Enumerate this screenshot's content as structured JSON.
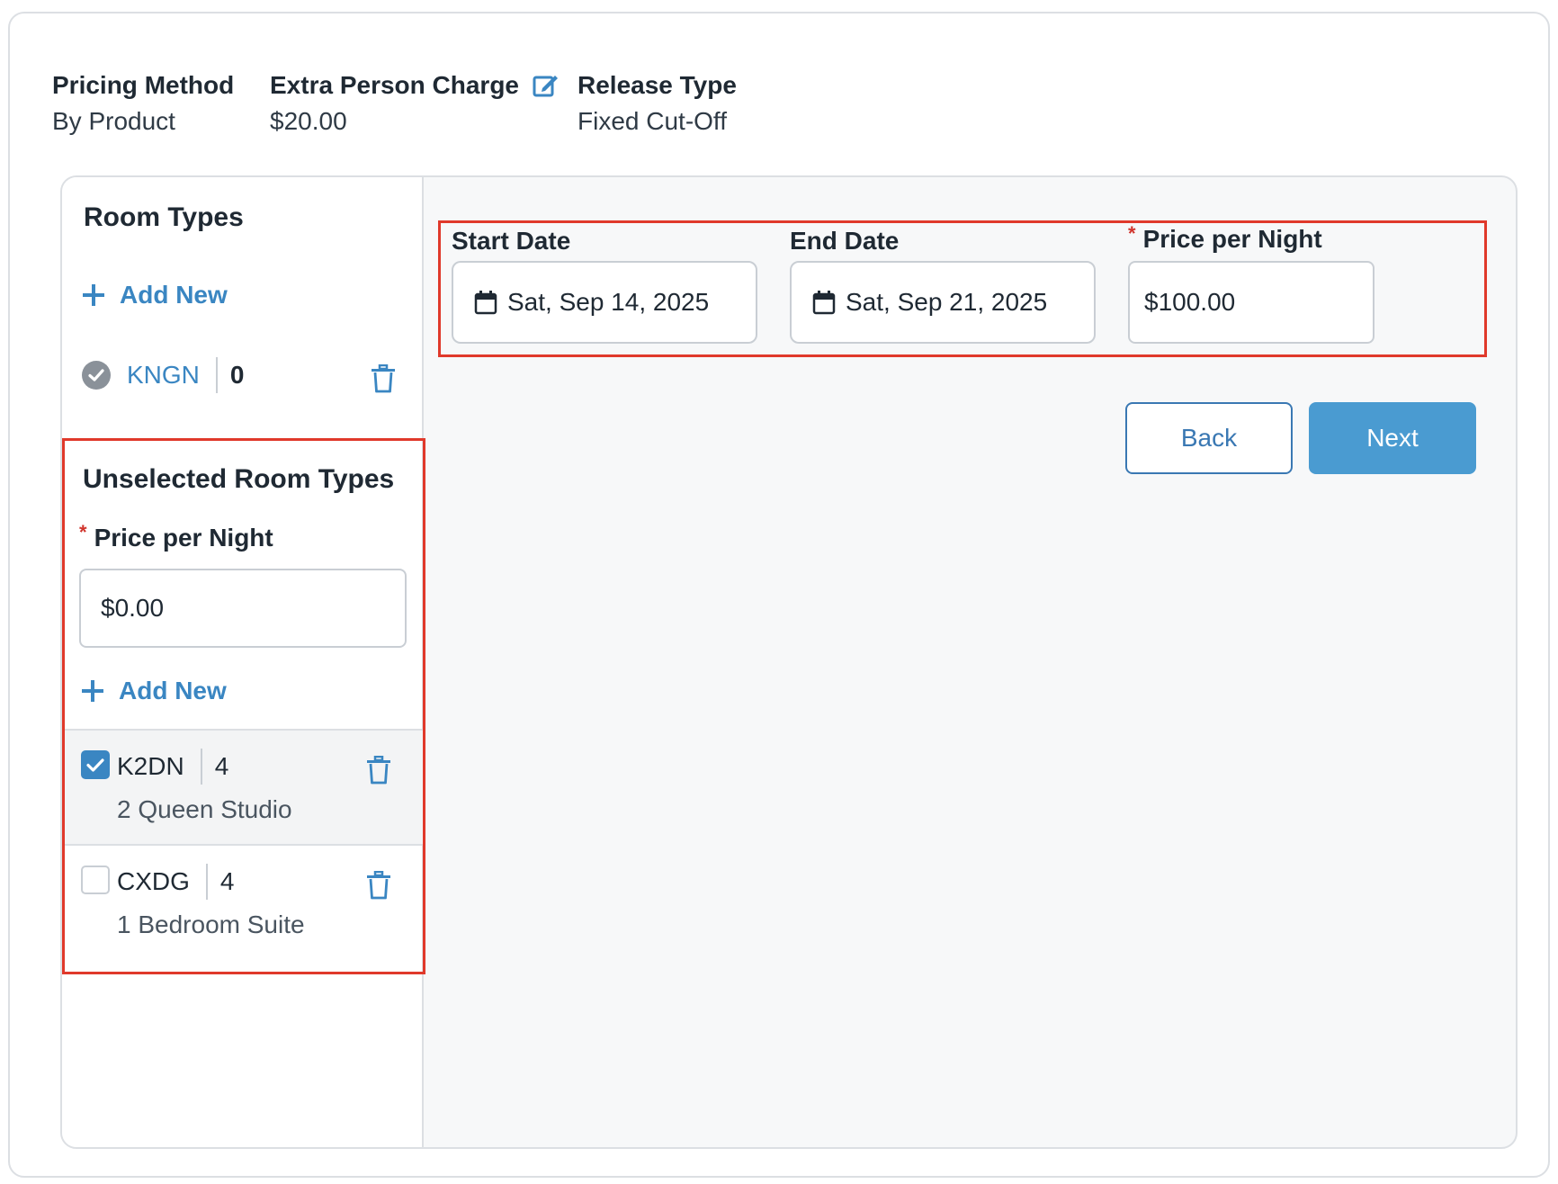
{
  "summary": {
    "pricing_method_label": "Pricing Method",
    "pricing_method_value": "By Product",
    "extra_person_label": "Extra Person Charge",
    "extra_person_value": "$20.00",
    "release_type_label": "Release Type",
    "release_type_value": "Fixed Cut-Off"
  },
  "room_types": {
    "title": "Room Types",
    "add_new_label": "Add New",
    "selected_item": {
      "code": "KNGN",
      "count": "0"
    }
  },
  "unselected": {
    "title": "Unselected Room Types",
    "price_label": "Price per Night",
    "price_value": "$0.00",
    "add_new_label": "Add New",
    "items": [
      {
        "code": "K2DN",
        "count": "4",
        "description": "2 Queen Studio",
        "checked": true
      },
      {
        "code": "CXDG",
        "count": "4",
        "description": "1 Bedroom Suite",
        "checked": false
      }
    ]
  },
  "pricing": {
    "start_date_label": "Start Date",
    "start_date_value": "Sat, Sep 14, 2025",
    "end_date_label": "End Date",
    "end_date_value": "Sat, Sep 21, 2025",
    "price_label": "Price per Night",
    "price_value": "$100.00"
  },
  "actions": {
    "back_label": "Back",
    "next_label": "Next"
  },
  "colors": {
    "accent": "#3a86c2",
    "highlight_border": "#e0392b",
    "primary_button": "#4a9bd1"
  },
  "icons": [
    "edit-icon",
    "plus-icon",
    "check-circle-icon",
    "trash-icon",
    "checkbox-check-icon",
    "calendar-icon"
  ]
}
